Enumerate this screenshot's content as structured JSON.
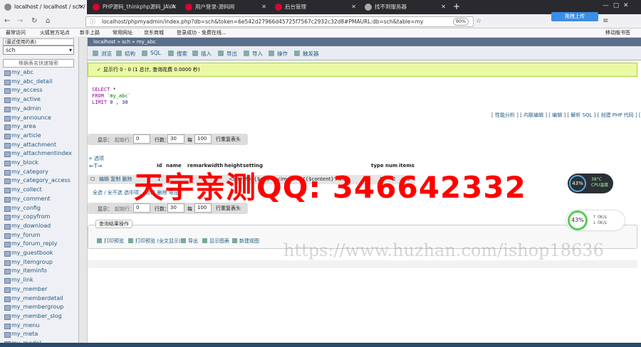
{
  "browser": {
    "tabs": [
      {
        "label": "localhost / localhost / sch / a",
        "active": true
      },
      {
        "label": "PHP源码_thinkphp源码_JAVA",
        "active": false
      },
      {
        "label": "用户登录-源码网",
        "active": false
      },
      {
        "label": "后台管理",
        "active": false
      },
      {
        "label": "找不到服务器",
        "active": false
      }
    ],
    "new_tab": "+",
    "url": "localhost/phpmyadmin/index.php?db=sch&token=6e542d27966d45725f7567c2932c32d8#PMAURL:db=sch&table=my",
    "zoom": "90%",
    "upload_button": "拖拽上传",
    "bookmarks": [
      "最常访问",
      "火狐官方站点",
      "新手上路",
      "常用网址",
      "京东商城",
      "登录成功 - 免费在线..."
    ],
    "bookmarks_right": "移动版书签"
  },
  "sidebar": {
    "recent_label": "(最近使用的表)",
    "db_select": "sch",
    "filter_placeholder": "根据表名快速搜索",
    "tables": [
      "my_abc",
      "my_abc_detail",
      "my_access",
      "my_active",
      "my_admin",
      "my_announce",
      "my_area",
      "my_article",
      "my_attachment",
      "my_attachmentindex",
      "my_block",
      "my_category",
      "my_category_access",
      "my_collect",
      "my_comment",
      "my_config",
      "my_copyfrom",
      "my_download",
      "my_forum",
      "my_forum_reply",
      "my_guestbook",
      "my_itemgroup",
      "my_iteminfo",
      "my_link",
      "my_member",
      "my_memberdetail",
      "my_membergroup",
      "my_member_slog",
      "my_menu",
      "my_meta",
      "my_model"
    ]
  },
  "main": {
    "breadcrumb": "localhost » sch » my_abc",
    "menu": [
      "浏览",
      "结构",
      "SQL",
      "搜索",
      "插入",
      "导出",
      "导入",
      "操作",
      "触发器"
    ],
    "success": "显示行 0 - 0 (1 总计, 查询花费 0.0000 秒)",
    "sql": {
      "select": "SELECT",
      "star": "*",
      "from": "FROM",
      "table": "`my_abc`",
      "limit": "LIMIT",
      "limit_val": "0 , 30"
    },
    "sql_links": "[ 性能分析 ] [ 内联编辑 ] [ 编辑 ] [ 解析 SQL ] [ 创建 PHP 代码 ] [ 刷新 ]",
    "nav": {
      "show": "显示：",
      "start_label": "起始行：",
      "start_val": "0",
      "rows_label": "行数：",
      "rows_val": "30",
      "sort_label": "每",
      "sort_val": "100",
      "sort_suffix": "行重复表头"
    },
    "options": "+ 选项",
    "arrows": "←T→",
    "columns": [
      "id",
      "name",
      "remark",
      "width",
      "height",
      "setting",
      "type",
      "num",
      "items"
    ],
    "row": {
      "actions": "编辑  复制  删除",
      "id": "1",
      "setting": "<a href=\"{$url}\"><img src=\"{$content}\" w...",
      "type": "2",
      "num": "2",
      "items": "3"
    },
    "bulk": "全选 / 全不选  选中项：  修改  删除  导出",
    "query_results_legend": "查询结果操作",
    "query_links": [
      "打印预览",
      "打印预览 (全文显示)",
      "导出",
      "显示图表",
      "新建视图"
    ]
  },
  "overlays": {
    "red_text": "天宇亲测QQ: 346642332",
    "watermark": "https://www.huzhan.com/ishop18636",
    "cpu_pct": "43%",
    "cpu_temp": "38°C",
    "cpu_label": "CPU温度",
    "mem_pct": "43%",
    "net_up": "0K/s",
    "net_down": "0K/s"
  }
}
